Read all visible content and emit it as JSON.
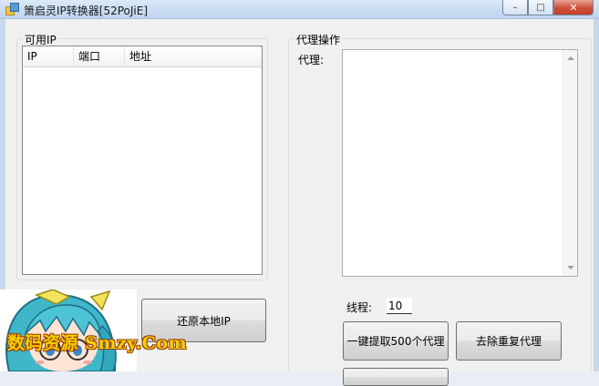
{
  "window": {
    "title": "箫启灵IP转换器[52PoJiE]",
    "controls": {
      "minimize": "–",
      "maximize": "□",
      "close": "✕"
    }
  },
  "available_ip": {
    "title": "可用IP",
    "columns": [
      "IP",
      "端口",
      "地址"
    ],
    "rows": []
  },
  "proxy_ops": {
    "title": "代理操作",
    "proxy_label": "代理:",
    "proxy_text": "",
    "threads_label": "线程:",
    "threads_value": "10"
  },
  "buttons": {
    "restore_local_ip": "还原本地IP",
    "fetch_500": "一键提取500个代理",
    "dedupe": "去除重复代理"
  },
  "watermark": "数码资源 Smzy.Com",
  "colors": {
    "title_bar": "#c9dcf2",
    "close_button": "#cf4d35",
    "watermark": "#f6d000"
  }
}
